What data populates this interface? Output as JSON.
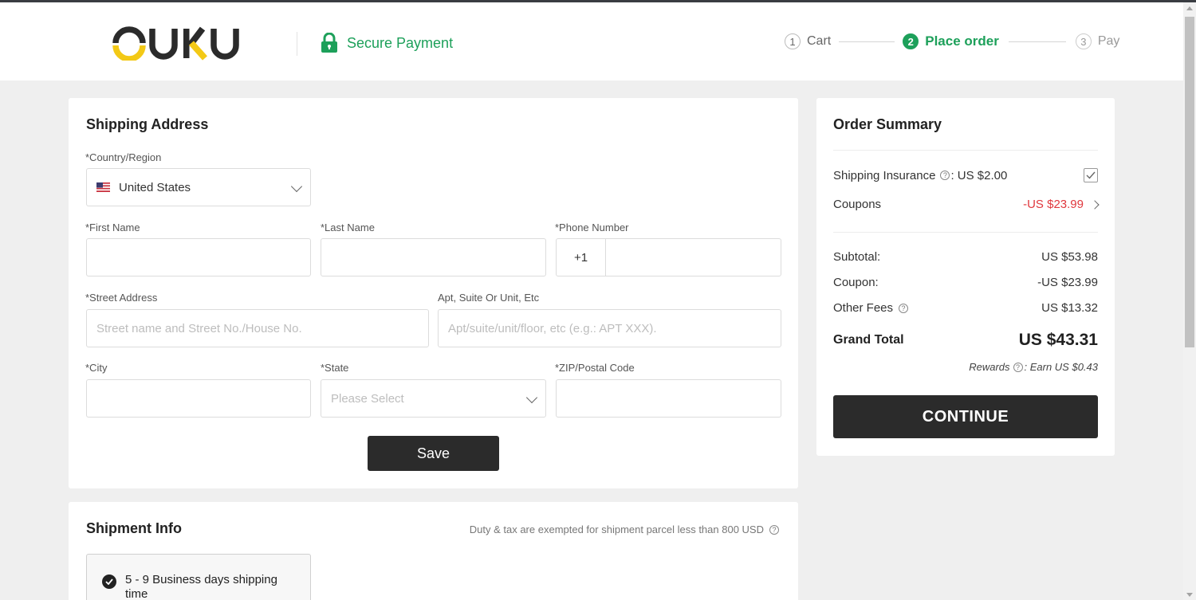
{
  "header": {
    "logo_text": "OUKU",
    "secure_label": "Secure Payment",
    "steps": [
      {
        "num": "1",
        "label": "Cart"
      },
      {
        "num": "2",
        "label": "Place order"
      },
      {
        "num": "3",
        "label": "Pay"
      }
    ],
    "colors": {
      "accent": "#1da05a",
      "logo_yellow": "#f3c916",
      "logo_dark": "#2b2b2b"
    }
  },
  "shipping": {
    "title": "Shipping Address",
    "country_label": "*Country/Region",
    "country_value": "United States",
    "first_name_label": "*First Name",
    "first_name_value": "",
    "last_name_label": "*Last Name",
    "last_name_value": "",
    "phone_label": "*Phone Number",
    "phone_prefix": "+1",
    "phone_value": "",
    "street_label": "*Street Address",
    "street_placeholder": "Street name and Street No./House No.",
    "apt_label": "Apt, Suite Or Unit, Etc",
    "apt_placeholder": "Apt/suite/unit/floor, etc (e.g.: APT XXX).",
    "city_label": "*City",
    "city_value": "",
    "state_label": "*State",
    "state_placeholder": "Please Select",
    "zip_label": "*ZIP/Postal Code",
    "zip_value": "",
    "save_label": "Save"
  },
  "shipment": {
    "title": "Shipment Info",
    "duty_note": "Duty & tax are exempted for shipment parcel less than 800 USD",
    "option_label": "5 - 9 Business days shipping time",
    "option_selected": true
  },
  "summary": {
    "title": "Order Summary",
    "insurance_label": "Shipping Insurance",
    "insurance_value": ": US $2.00",
    "insurance_checked": true,
    "coupons_label": "Coupons",
    "coupons_value": "-US $23.99",
    "subtotal_label": "Subtotal:",
    "subtotal_value": "US $53.98",
    "coupon_label": "Coupon:",
    "coupon_value": "-US $23.99",
    "other_fees_label": "Other Fees",
    "other_fees_value": "US $13.32",
    "grand_total_label": "Grand Total",
    "grand_total_value": "US $43.31",
    "rewards_label": "Rewards",
    "rewards_value": ": Earn US $0.43",
    "continue_label": "CONTINUE"
  },
  "icons": {
    "help": "?"
  }
}
